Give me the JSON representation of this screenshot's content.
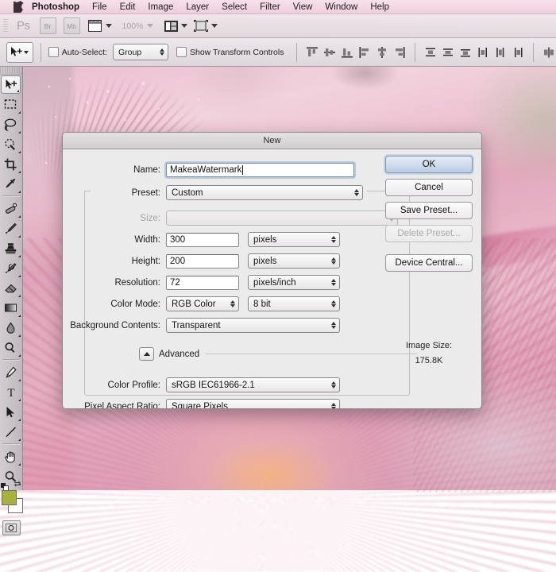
{
  "menubar": {
    "apple_icon": "apple-logo-icon",
    "items": [
      {
        "label": "Photoshop",
        "bold": true
      },
      {
        "label": "File"
      },
      {
        "label": "Edit"
      },
      {
        "label": "Image"
      },
      {
        "label": "Layer"
      },
      {
        "label": "Select"
      },
      {
        "label": "Filter"
      },
      {
        "label": "View"
      },
      {
        "label": "Window"
      },
      {
        "label": "Help"
      }
    ]
  },
  "appbar": {
    "ps_logo": "Ps",
    "bridge_label": "Br",
    "minibridge_label": "Mb",
    "zoom_level": "100%",
    "icons": [
      "view-extras-icon",
      "screen-mode-icon",
      "arrange-documents-icon"
    ]
  },
  "optionsbar": {
    "tool_icon": "move-tool-icon",
    "auto_select_label": "Auto-Select:",
    "auto_select_checked": false,
    "auto_select_value": "Group",
    "show_transform_label": "Show Transform Controls",
    "show_transform_checked": false,
    "align_icons": [
      "align-top-edges-icon",
      "align-vertical-centers-icon",
      "align-bottom-edges-icon",
      "align-left-edges-icon",
      "align-horizontal-centers-icon",
      "align-right-edges-icon"
    ],
    "distribute_icons": [
      "distribute-top-edges-icon",
      "distribute-vertical-centers-icon",
      "distribute-bottom-edges-icon",
      "distribute-left-edges-icon",
      "distribute-horizontal-centers-icon",
      "distribute-right-edges-icon"
    ],
    "extra_icons": [
      "auto-align-layers-icon"
    ]
  },
  "toolbox": {
    "foreground_color": "#a8b23a",
    "background_color": "#ffffff",
    "tools": [
      {
        "name": "move-tool",
        "active": true,
        "has_flyout": true
      },
      {
        "name": "rectangular-marquee-tool",
        "has_flyout": true
      },
      {
        "name": "lasso-tool",
        "has_flyout": true
      },
      {
        "name": "quick-selection-tool",
        "has_flyout": true
      },
      {
        "name": "crop-tool",
        "has_flyout": true
      },
      {
        "name": "eyedropper-tool",
        "has_flyout": true
      },
      {
        "name": "spot-healing-brush-tool",
        "has_flyout": true
      },
      {
        "name": "brush-tool",
        "has_flyout": true
      },
      {
        "name": "clone-stamp-tool",
        "has_flyout": true
      },
      {
        "name": "history-brush-tool",
        "has_flyout": true
      },
      {
        "name": "eraser-tool",
        "has_flyout": true
      },
      {
        "name": "gradient-tool",
        "has_flyout": true
      },
      {
        "name": "blur-tool",
        "has_flyout": true
      },
      {
        "name": "dodge-tool",
        "has_flyout": true
      },
      {
        "name": "pen-tool",
        "has_flyout": true
      },
      {
        "name": "horizontal-type-tool",
        "has_flyout": true
      },
      {
        "name": "path-selection-tool",
        "has_flyout": true
      },
      {
        "name": "line-tool",
        "has_flyout": true
      },
      {
        "name": "hand-tool",
        "has_flyout": true
      },
      {
        "name": "zoom-tool",
        "has_flyout": true
      }
    ],
    "quick_mask_icon": "quick-mask-mode-icon"
  },
  "dialog": {
    "title": "New",
    "fields": {
      "name_label": "Name:",
      "name_value": "MakeaWatermark",
      "preset_label": "Preset:",
      "preset_value": "Custom",
      "size_label": "Size:",
      "size_value": "",
      "size_disabled": true,
      "width_label": "Width:",
      "width_value": "300",
      "width_unit": "pixels",
      "height_label": "Height:",
      "height_value": "200",
      "height_unit": "pixels",
      "resolution_label": "Resolution:",
      "resolution_value": "72",
      "resolution_unit": "pixels/inch",
      "color_mode_label": "Color Mode:",
      "color_mode_value": "RGB Color",
      "bit_depth_value": "8 bit",
      "background_contents_label": "Background Contents:",
      "background_contents_value": "Transparent",
      "advanced_label": "Advanced",
      "advanced_expanded": true,
      "color_profile_label": "Color Profile:",
      "color_profile_value": "sRGB IEC61966-2.1",
      "pixel_aspect_label": "Pixel Aspect Ratio:",
      "pixel_aspect_value": "Square Pixels"
    },
    "buttons": {
      "ok": "OK",
      "cancel": "Cancel",
      "save_preset": "Save Preset...",
      "delete_preset": "Delete Preset...",
      "delete_preset_disabled": true,
      "device_central": "Device Central..."
    },
    "image_size": {
      "label": "Image Size:",
      "value": "175.8K"
    }
  }
}
